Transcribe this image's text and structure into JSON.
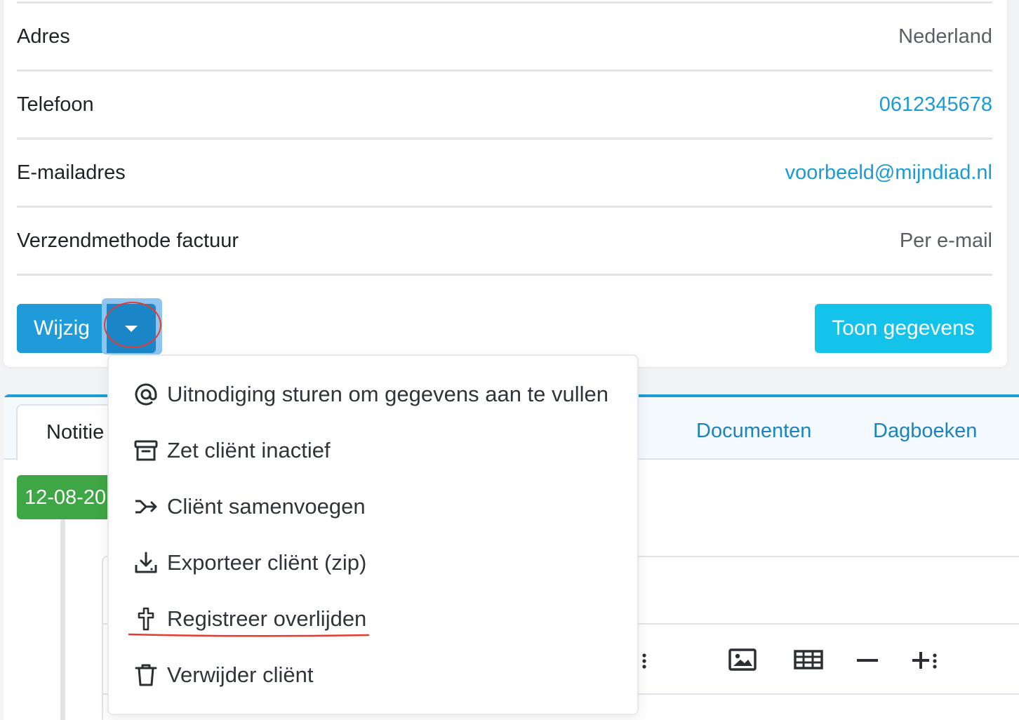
{
  "details": {
    "rows": [
      {
        "label": "Adres",
        "value": "Nederland",
        "is_link": false
      },
      {
        "label": "Telefoon",
        "value": "0612345678",
        "is_link": true
      },
      {
        "label": "E-mailadres",
        "value": "voorbeeld@mijndiad.nl",
        "is_link": true
      },
      {
        "label": "Verzendmethode factuur",
        "value": "Per e-mail",
        "is_link": false
      }
    ]
  },
  "actions": {
    "edit_label": "Wijzig",
    "dropdown_icon": "caret-down-icon",
    "show_data_label": "Toon gegevens"
  },
  "dropdown_menu": {
    "items": [
      {
        "label": "Uitnodiging sturen om gegevens aan te vullen",
        "icon": "at-icon"
      },
      {
        "label": "Zet cliënt inactief",
        "icon": "archive-icon"
      },
      {
        "label": "Cliënt samenvoegen",
        "icon": "merge-icon"
      },
      {
        "label": "Exporteer cliënt (zip)",
        "icon": "download-icon"
      },
      {
        "label": "Registreer overlijden",
        "icon": "cross-icon"
      },
      {
        "label": "Verwijder cliënt",
        "icon": "trash-icon"
      }
    ]
  },
  "tabs": [
    {
      "label": "Notitie",
      "active": true
    },
    {
      "label": "Documenten",
      "active": false
    },
    {
      "label": "Dagboeken",
      "active": false
    }
  ],
  "timeline": {
    "date_badge": "12-08-20"
  },
  "editor_toolbar": {
    "icons": [
      "more-icon",
      "image-icon",
      "table-icon",
      "horizontal-rule-icon",
      "insert-more-icon"
    ]
  },
  "colors": {
    "primary": "#1f9bd9",
    "primary_dark": "#1a86c7",
    "info": "#14c3ea",
    "success": "#3ea645",
    "link": "#1a9bd7",
    "annotation": "#e53b2f"
  }
}
